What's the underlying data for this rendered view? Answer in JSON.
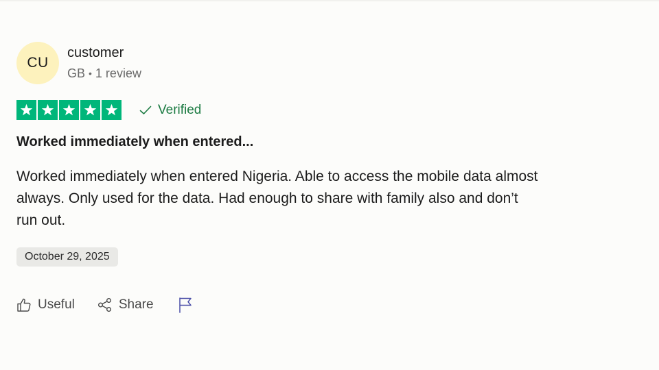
{
  "reviewer": {
    "initials": "CU",
    "name": "customer",
    "country": "GB",
    "separator": "•",
    "review_count": "1 review"
  },
  "rating": {
    "stars": 5,
    "max_stars": 5,
    "star_color": "#00b67a",
    "verified_label": "Verified",
    "verified_color": "#1a7a41"
  },
  "review": {
    "title": "Worked immediately when entered...",
    "body": "Worked immediately when entered Nigeria. Able to access the mobile data almost always. Only used for the data. Had enough to share with family also and don’t run out.",
    "date": "October 29, 2025"
  },
  "actions": {
    "useful_label": "Useful",
    "useful_icon": "thumbs-up-icon",
    "share_label": "Share",
    "share_icon": "share-icon",
    "report_icon": "flag-icon"
  },
  "colors": {
    "avatar_bg": "#fdf2bd",
    "flag_color": "#4b4fa8"
  }
}
